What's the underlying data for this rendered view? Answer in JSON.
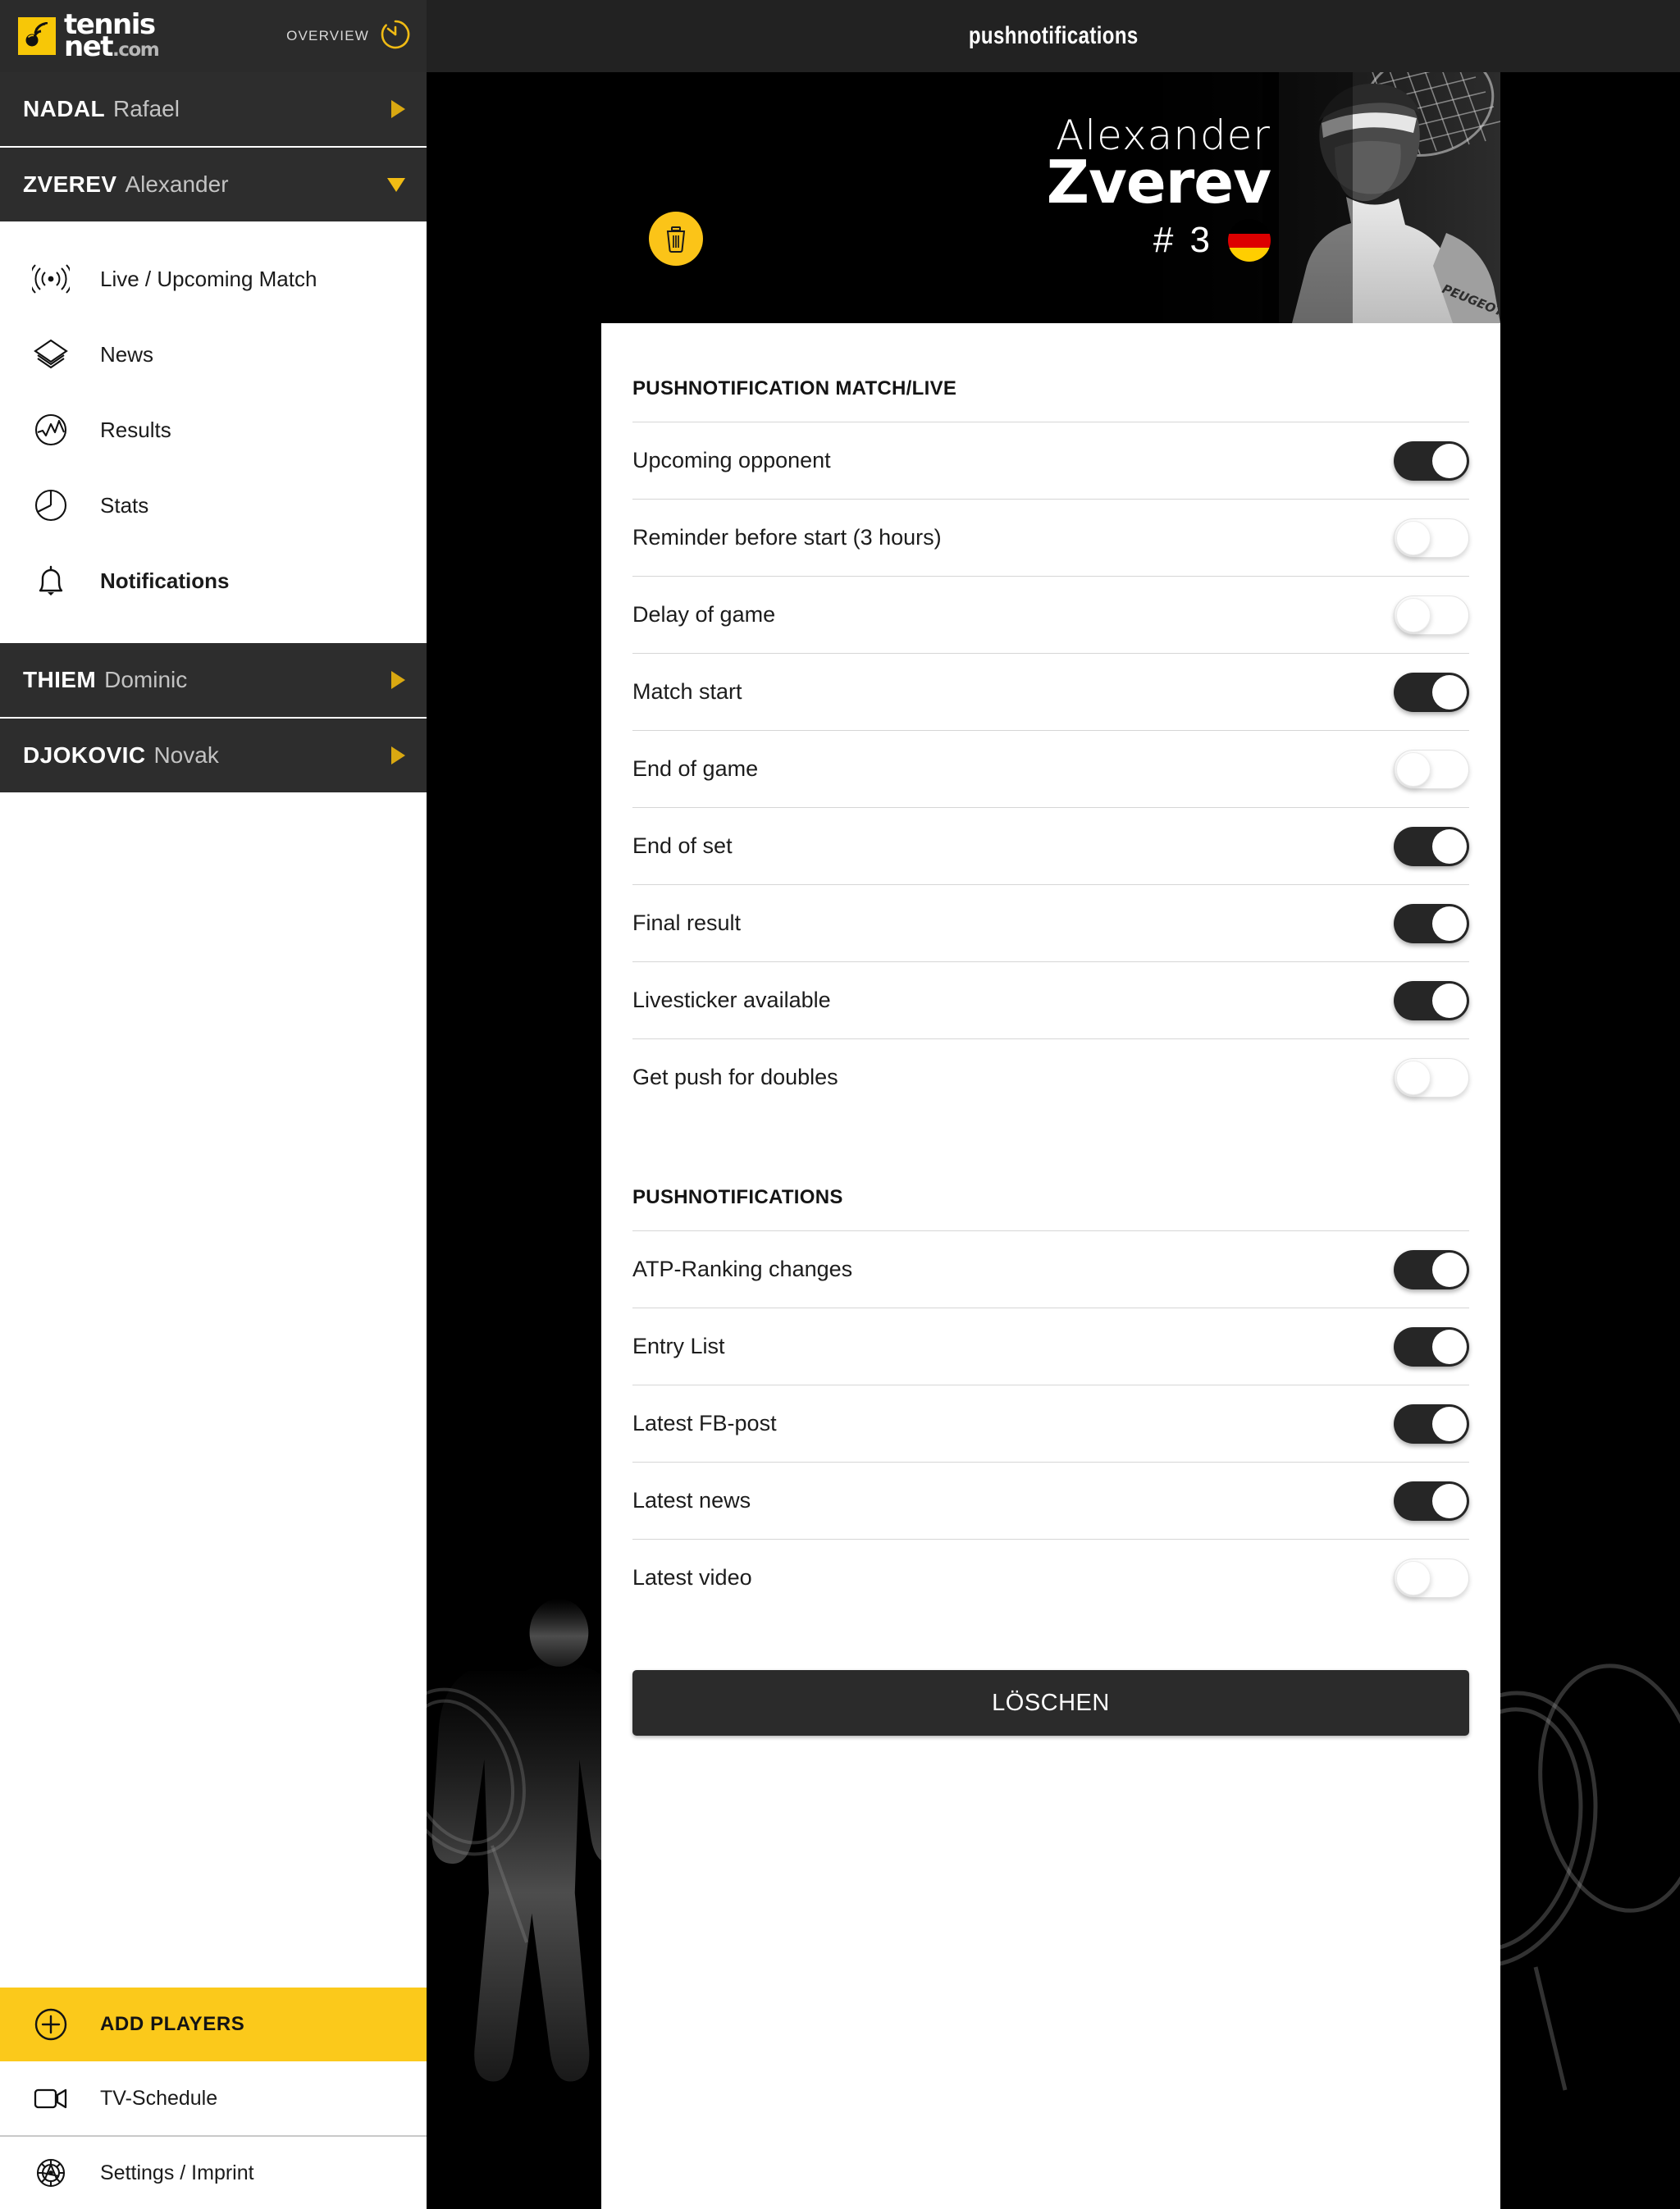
{
  "brand": {
    "logo_line1": "tennis",
    "logo_line2": "net",
    "logo_domain": ".com",
    "overview_label": "OVERVIEW",
    "accent_yellow": "#f7c707"
  },
  "topbar": {
    "title": "pushnotifications"
  },
  "sidebar": {
    "players": [
      {
        "last": "NADAL",
        "first": "Rafael",
        "expanded": false
      },
      {
        "last": "ZVEREV",
        "first": "Alexander",
        "expanded": true
      },
      {
        "last": "THIEM",
        "first": "Dominic",
        "expanded": false
      },
      {
        "last": "DJOKOVIC",
        "first": "Novak",
        "expanded": false
      }
    ],
    "submenu": [
      {
        "label": "Live / Upcoming Match",
        "icon": "broadcast-icon",
        "active": false
      },
      {
        "label": "News",
        "icon": "layers-icon",
        "active": false
      },
      {
        "label": "Results",
        "icon": "chart-circle-icon",
        "active": false
      },
      {
        "label": "Stats",
        "icon": "pie-chart-icon",
        "active": false
      },
      {
        "label": "Notifications",
        "icon": "bell-icon",
        "active": true
      }
    ],
    "add_players": {
      "label": "ADD PLAYERS",
      "icon": "plus-circle-icon"
    },
    "bottom": [
      {
        "label": "TV-Schedule",
        "icon": "video-camera-icon"
      },
      {
        "label": "Settings / Imprint",
        "icon": "gear-icon"
      }
    ]
  },
  "hero": {
    "first_name": "Alexander",
    "last_name": "Zverev",
    "rank": "# 3",
    "flag_country": "germany",
    "flag_colors": [
      "#000000",
      "#dd0000",
      "#ffce00"
    ],
    "delete_icon": "trash-icon"
  },
  "sections": [
    {
      "title": "PUSHNOTIFICATION MATCH/LIVE",
      "rows": [
        {
          "label": "Upcoming opponent",
          "on": true
        },
        {
          "label": "Reminder before start (3 hours)",
          "on": false
        },
        {
          "label": "Delay of game",
          "on": false
        },
        {
          "label": "Match start",
          "on": true
        },
        {
          "label": "End of game",
          "on": false
        },
        {
          "label": "End of set",
          "on": true
        },
        {
          "label": "Final result",
          "on": true
        },
        {
          "label": "Livesticker available",
          "on": true
        },
        {
          "label": "Get push for doubles",
          "on": false
        }
      ]
    },
    {
      "title": "PUSHNOTIFICATIONS",
      "rows": [
        {
          "label": "ATP-Ranking changes",
          "on": true
        },
        {
          "label": "Entry List",
          "on": true
        },
        {
          "label": "Latest FB-post",
          "on": true
        },
        {
          "label": "Latest news",
          "on": true
        },
        {
          "label": "Latest video",
          "on": false
        }
      ]
    }
  ],
  "delete_button": {
    "label": "LÖSCHEN"
  }
}
